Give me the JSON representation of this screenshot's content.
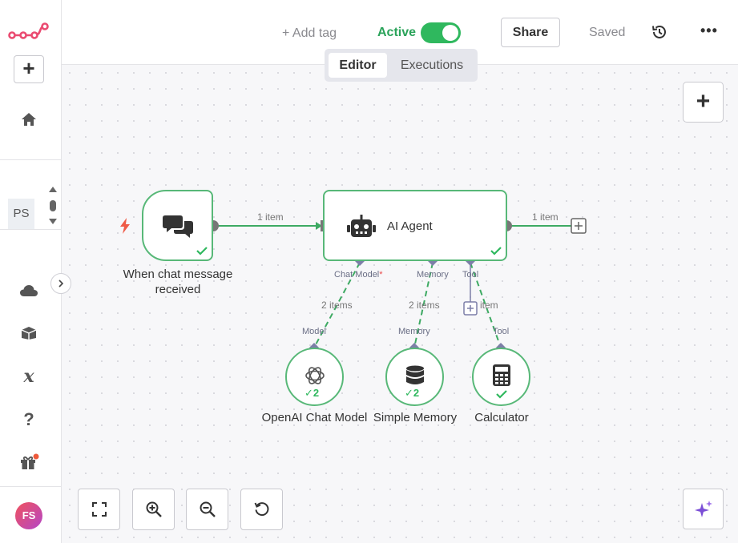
{
  "sidebar": {
    "logo": "n8n-logo",
    "add_label": "+",
    "workspace_badge": "PS",
    "avatar_initials": "FS",
    "icons": [
      "home-icon",
      "cloud-icon",
      "template-box-icon",
      "variables-icon",
      "help-icon",
      "gift-icon"
    ]
  },
  "header": {
    "add_tag": "+ Add tag",
    "active_label": "Active",
    "active": true,
    "share": "Share",
    "saved": "Saved",
    "more": "•••",
    "tabs": [
      "Editor",
      "Executions"
    ],
    "selected_tab": "Editor"
  },
  "canvas": {
    "add_node": "+",
    "nodes": {
      "trigger": "When chat message received",
      "agent": "AI Agent",
      "openai": "OpenAI Chat Model",
      "memory": "Simple Memory",
      "calculator": "Calculator"
    },
    "badges": {
      "openai_count": "2",
      "memory_count": "2"
    },
    "edge_labels": {
      "trigger_to_agent": "1 item",
      "agent_out": "1 item",
      "model_items": "2 items",
      "memory_items": "2 items",
      "tool_items": "item"
    },
    "connectors": {
      "agent_model": "Chat Model",
      "required_mark": "*",
      "agent_memory": "Memory",
      "agent_tool": "Tool",
      "sub_model": "Model",
      "sub_memory": "Memory",
      "sub_tool": "Tool"
    }
  },
  "colors": {
    "accent": "#ea4b71",
    "success": "#2fb85e",
    "node_border": "#58b878",
    "connector": "#7d7fa8"
  }
}
